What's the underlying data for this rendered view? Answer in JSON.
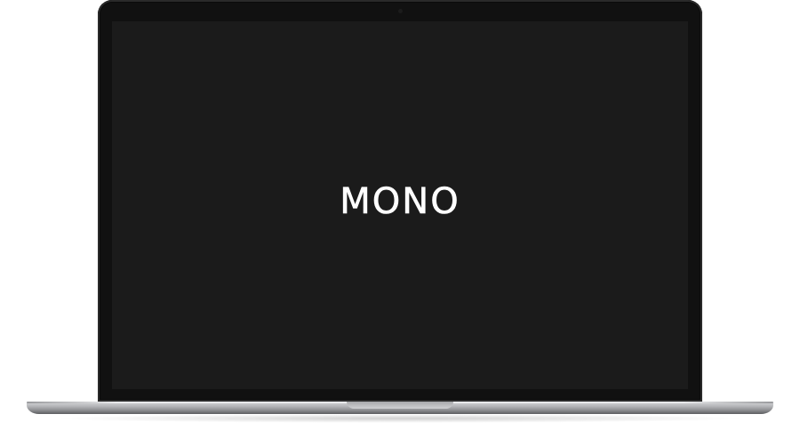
{
  "screen": {
    "logo_text": "MONO",
    "background": "#1b1b1b",
    "text_color": "#ffffff"
  },
  "device": {
    "bezel_color": "#111111",
    "body_color": "#b8b9bc"
  }
}
